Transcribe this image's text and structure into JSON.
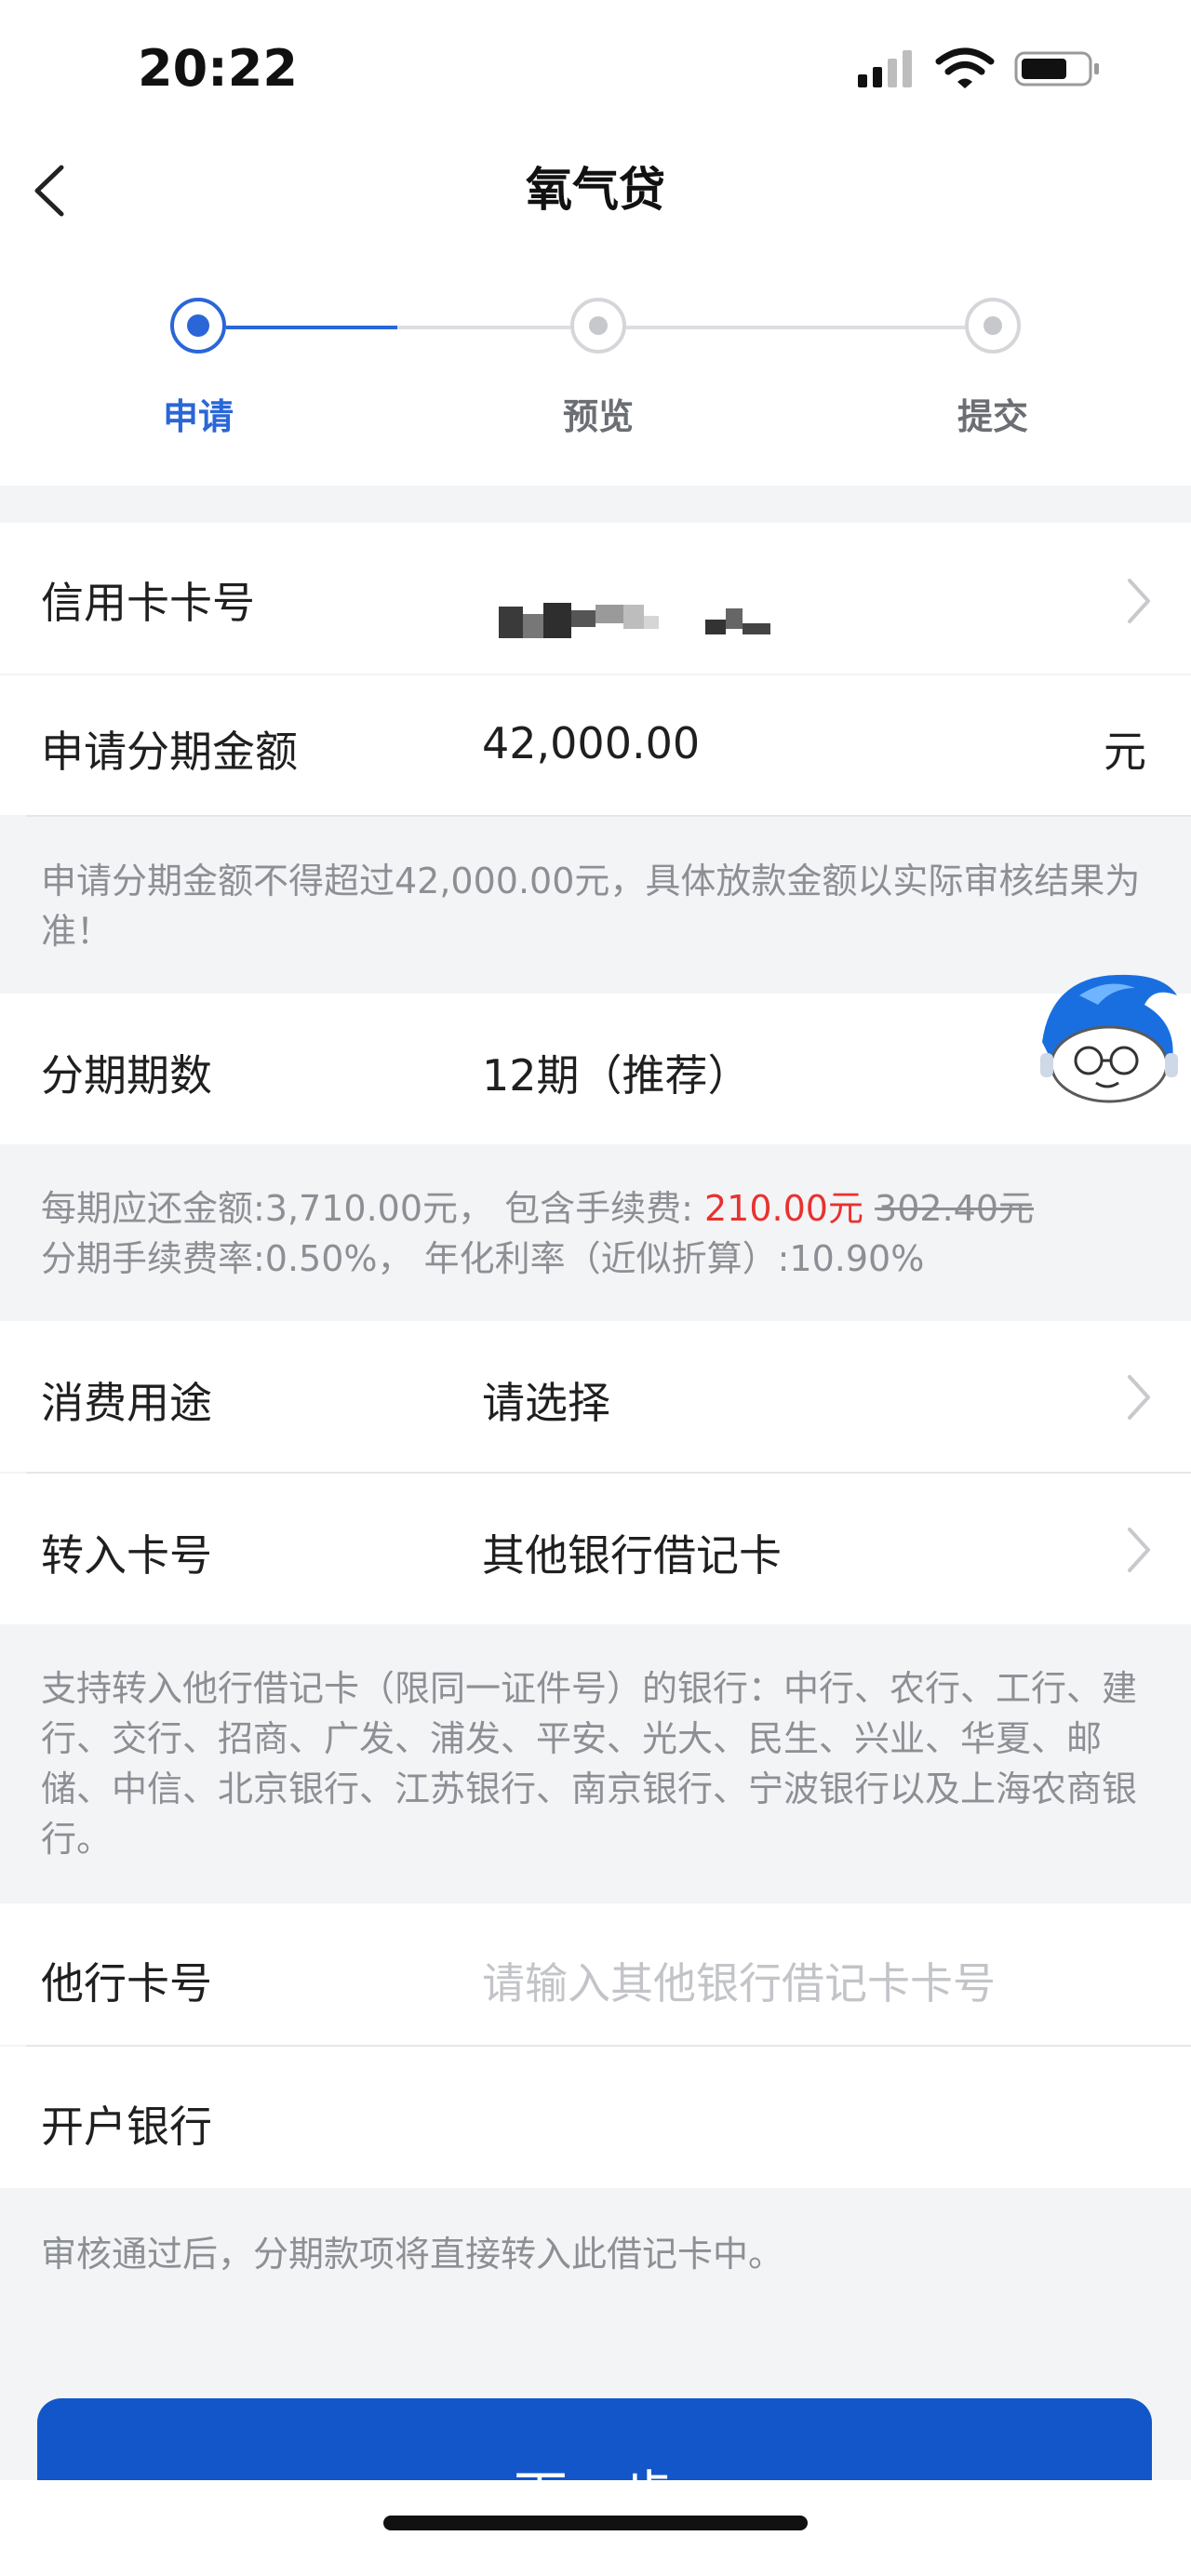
{
  "status_bar": {
    "time": "20:22"
  },
  "nav": {
    "title": "氧气贷"
  },
  "steps": [
    {
      "label": "申请",
      "color": "#2a66d8"
    },
    {
      "label": "预览",
      "color": "#6b6e73"
    },
    {
      "label": "提交",
      "color": "#6b6e73"
    }
  ],
  "form": {
    "credit_card": {
      "label": "信用卡卡号"
    },
    "amount": {
      "label": "申请分期金额",
      "value": "42,000.00",
      "unit": "元"
    },
    "amount_note": "申请分期金额不得超过42,000.00元，具体放款金额以实际审核结果为准！",
    "term": {
      "label": "分期期数",
      "value": "12期（推荐）"
    },
    "term_note": {
      "line1_prefix": "每期应还金额:3,710.00元， 包含手续费: ",
      "fee": "210.00元",
      "original_fee": "302.40元",
      "line2": "分期手续费率:0.50%， 年化利率（近似折算）:10.90%"
    },
    "purpose": {
      "label": "消费用途",
      "value": "请选择"
    },
    "transfer_card": {
      "label": "转入卡号",
      "value": "其他银行借记卡"
    },
    "bank_note": "支持转入他行借记卡（限同一证件号）的银行：中行、农行、工行、建行、交行、招商、广发、浦发、平安、光大、民生、兴业、华夏、邮储、中信、北京银行、江苏银行、南京银行、宁波银行以及上海农商银行。",
    "other_card": {
      "label": "他行卡号",
      "placeholder": "请输入其他银行借记卡卡号"
    },
    "open_bank": {
      "label": "开户银行"
    },
    "final_note": "审核通过后，分期款项将直接转入此借记卡中。"
  },
  "next_button": {
    "label": "下一步"
  },
  "colors": {
    "accent": "#2a66d8",
    "button": "#1256c9",
    "fee_red": "#e8322f"
  },
  "icons": [
    "back-chevron-icon",
    "chevron-right-icon",
    "signal-icon",
    "wifi-icon",
    "battery-icon",
    "mascot-icon"
  ]
}
